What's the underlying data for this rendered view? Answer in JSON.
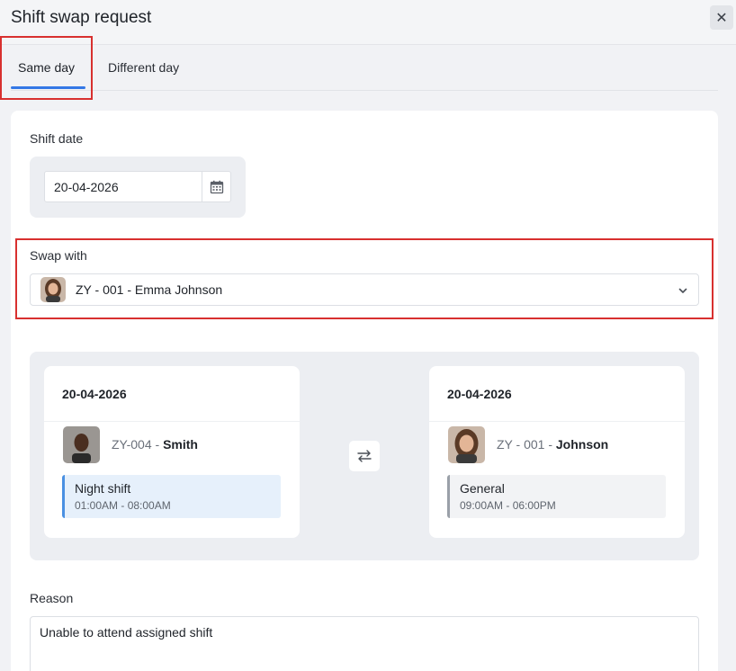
{
  "dialog": {
    "title": "Shift swap request",
    "close_icon": "close-icon"
  },
  "tabs": [
    {
      "label": "Same day",
      "active": true
    },
    {
      "label": "Different day",
      "active": false
    }
  ],
  "shift_date": {
    "label": "Shift date",
    "value": "20-04-2026",
    "icon": "calendar-icon"
  },
  "swap_with": {
    "label": "Swap with",
    "selected": "ZY - 001 - Emma Johnson",
    "icon": "chevron-down-icon"
  },
  "swap_summary": {
    "left": {
      "date": "20-04-2026",
      "emp_id": "ZY-004 - ",
      "emp_name": "Smith",
      "shift_name": "Night shift",
      "shift_time": "01:00AM - 08:00AM",
      "shift_color": "#4a90e2"
    },
    "right": {
      "date": "20-04-2026",
      "emp_id": "ZY - 001 - ",
      "emp_name": "Johnson",
      "shift_name": "General",
      "shift_time": "09:00AM - 06:00PM",
      "shift_color": "#9aa0a8"
    },
    "swap_icon": "swap-arrows-icon"
  },
  "reason": {
    "label": "Reason",
    "value": "Unable to attend assigned shift"
  },
  "colors": {
    "accent": "#3478e6",
    "highlight": "#d8302f"
  }
}
